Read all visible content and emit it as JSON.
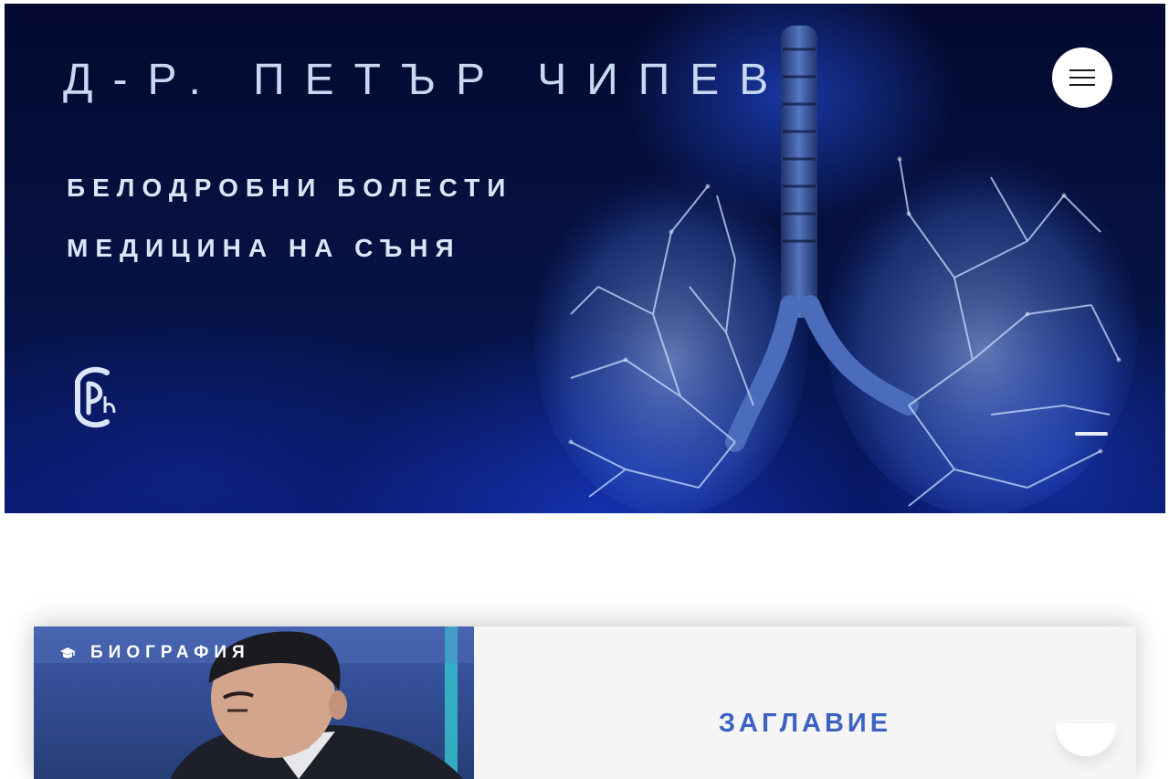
{
  "hero": {
    "title": "Д-Р. ПЕТЪР ЧИПЕВ",
    "specialties": [
      "БЕЛОДРОБНИ БОЛЕСТИ",
      "МЕДИЦИНА НА СЪНЯ"
    ],
    "logo_text": "CPh",
    "menu_icon": "hamburger-icon",
    "background_image": "lungs-illustration"
  },
  "bio_section": {
    "label": "БИОГРАФИЯ",
    "label_icon": "graduation-cap-icon",
    "heading": "ЗАГЛАВИЕ",
    "photo": "doctor-photo"
  },
  "colors": {
    "hero_bg": "#061345",
    "hero_text": "#c9d8f2",
    "heading_accent": "#3c63c2",
    "card_bg": "#f5f5f5"
  }
}
